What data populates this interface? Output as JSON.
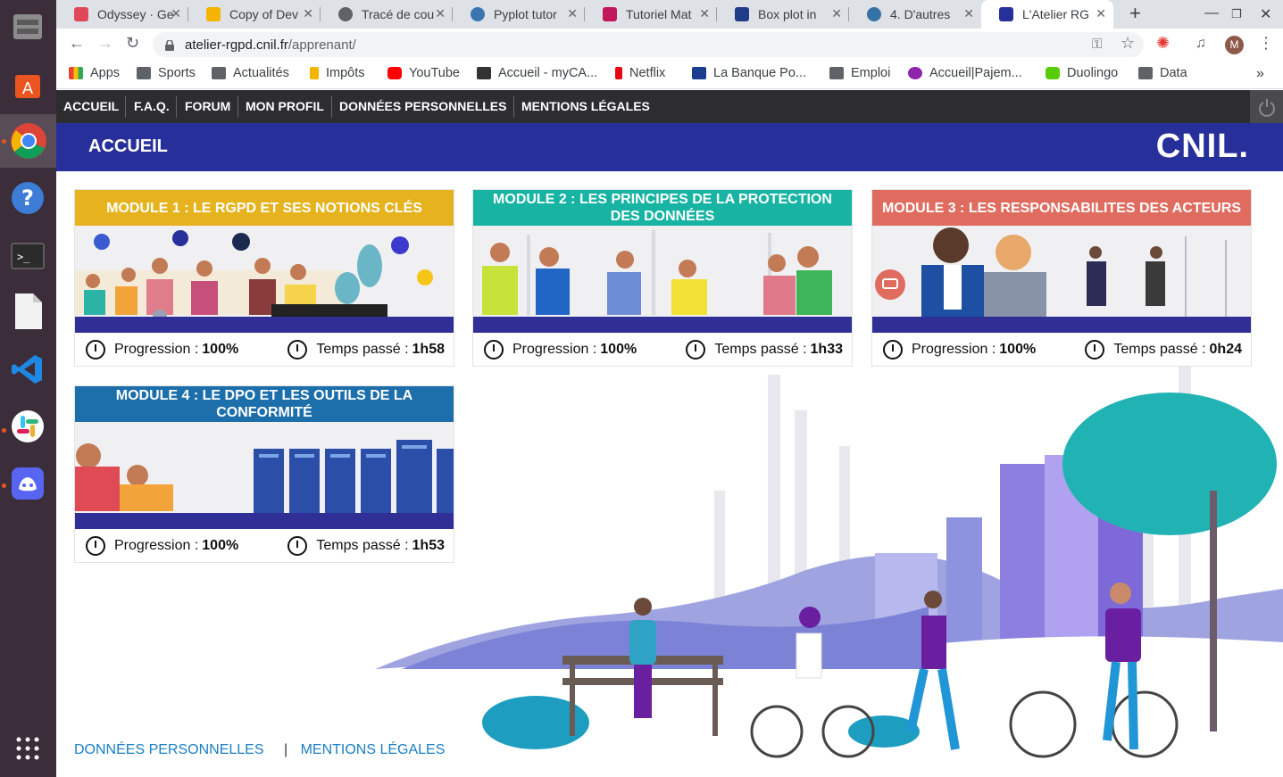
{
  "browser": {
    "tabs": [
      {
        "title": "Odyssey · Ge",
        "favicon_color": "#e0485a"
      },
      {
        "title": "Copy of Dev",
        "favicon_color": "#f4b400"
      },
      {
        "title": "Tracé de cou",
        "favicon_color": "#5f6368"
      },
      {
        "title": "Pyplot tutor",
        "favicon_color": "#3b75af"
      },
      {
        "title": "Tutoriel Mat",
        "favicon_color": "#c2185b"
      },
      {
        "title": "Box plot in",
        "favicon_color": "#1f3c88"
      },
      {
        "title": "4. D'autres",
        "favicon_color": "#3572A5"
      },
      {
        "title": "L'Atelier RG",
        "favicon_color": "#27309a"
      }
    ],
    "url_domain": "atelier-rgpd.cnil.fr",
    "url_path": "/apprenant/",
    "profile_initial": "M",
    "bookmarks": [
      {
        "label": "Apps",
        "color": "#ea4335"
      },
      {
        "label": "Sports",
        "color": "#5f6368"
      },
      {
        "label": "Actualités",
        "color": "#5f6368"
      },
      {
        "label": "Impôts",
        "color": "#f4b400"
      },
      {
        "label": "YouTube",
        "color": "#ff0000"
      },
      {
        "label": "Accueil - myCA...",
        "color": "#333333"
      },
      {
        "label": "Netflix",
        "color": "#e50914"
      },
      {
        "label": "La Banque Po...",
        "color": "#1a3d8f"
      },
      {
        "label": "Emploi",
        "color": "#5f6368"
      },
      {
        "label": "Accueil|Pajem...",
        "color": "#8e24aa"
      },
      {
        "label": "Duolingo",
        "color": "#58cc02"
      },
      {
        "label": "Data",
        "color": "#5f6368"
      }
    ],
    "bookmarks_more": "»"
  },
  "nav": {
    "items": [
      "ACCUEIL",
      "F.A.Q.",
      "FORUM",
      "MON PROFIL",
      "DONNÉES PERSONNELLES",
      "MENTIONS LÉGALES"
    ]
  },
  "banner": {
    "title": "ACCUEIL",
    "logo": "CNIL."
  },
  "modules": [
    {
      "title": "MODULE 1 : LE RGPD ET SES NOTIONS CLÉS",
      "color": "#e6b31e",
      "progress_label": "Progression :",
      "progress": "100%",
      "time_label": "Temps passé :",
      "time": "1h58"
    },
    {
      "title": "MODULE 2 : LES PRINCIPES DE LA PROTECTION DES DONNÉES",
      "color": "#17b3a3",
      "progress_label": "Progression :",
      "progress": "100%",
      "time_label": "Temps passé :",
      "time": "1h33"
    },
    {
      "title": "MODULE 3 : LES RESPONSABILITES DES ACTEURS",
      "color": "#e06c5f",
      "progress_label": "Progression :",
      "progress": "100%",
      "time_label": "Temps passé :",
      "time": "0h24"
    },
    {
      "title": "MODULE 4 : LE DPO ET LES OUTILS DE LA CONFORMITÉ",
      "color": "#1c6fab",
      "progress_label": "Progression :",
      "progress": "100%",
      "time_label": "Temps passé :",
      "time": "1h53"
    }
  ],
  "footer": {
    "link1": "DONNÉES PERSONNELLES",
    "separator": "|",
    "link2": "MENTIONS LÉGALES"
  }
}
